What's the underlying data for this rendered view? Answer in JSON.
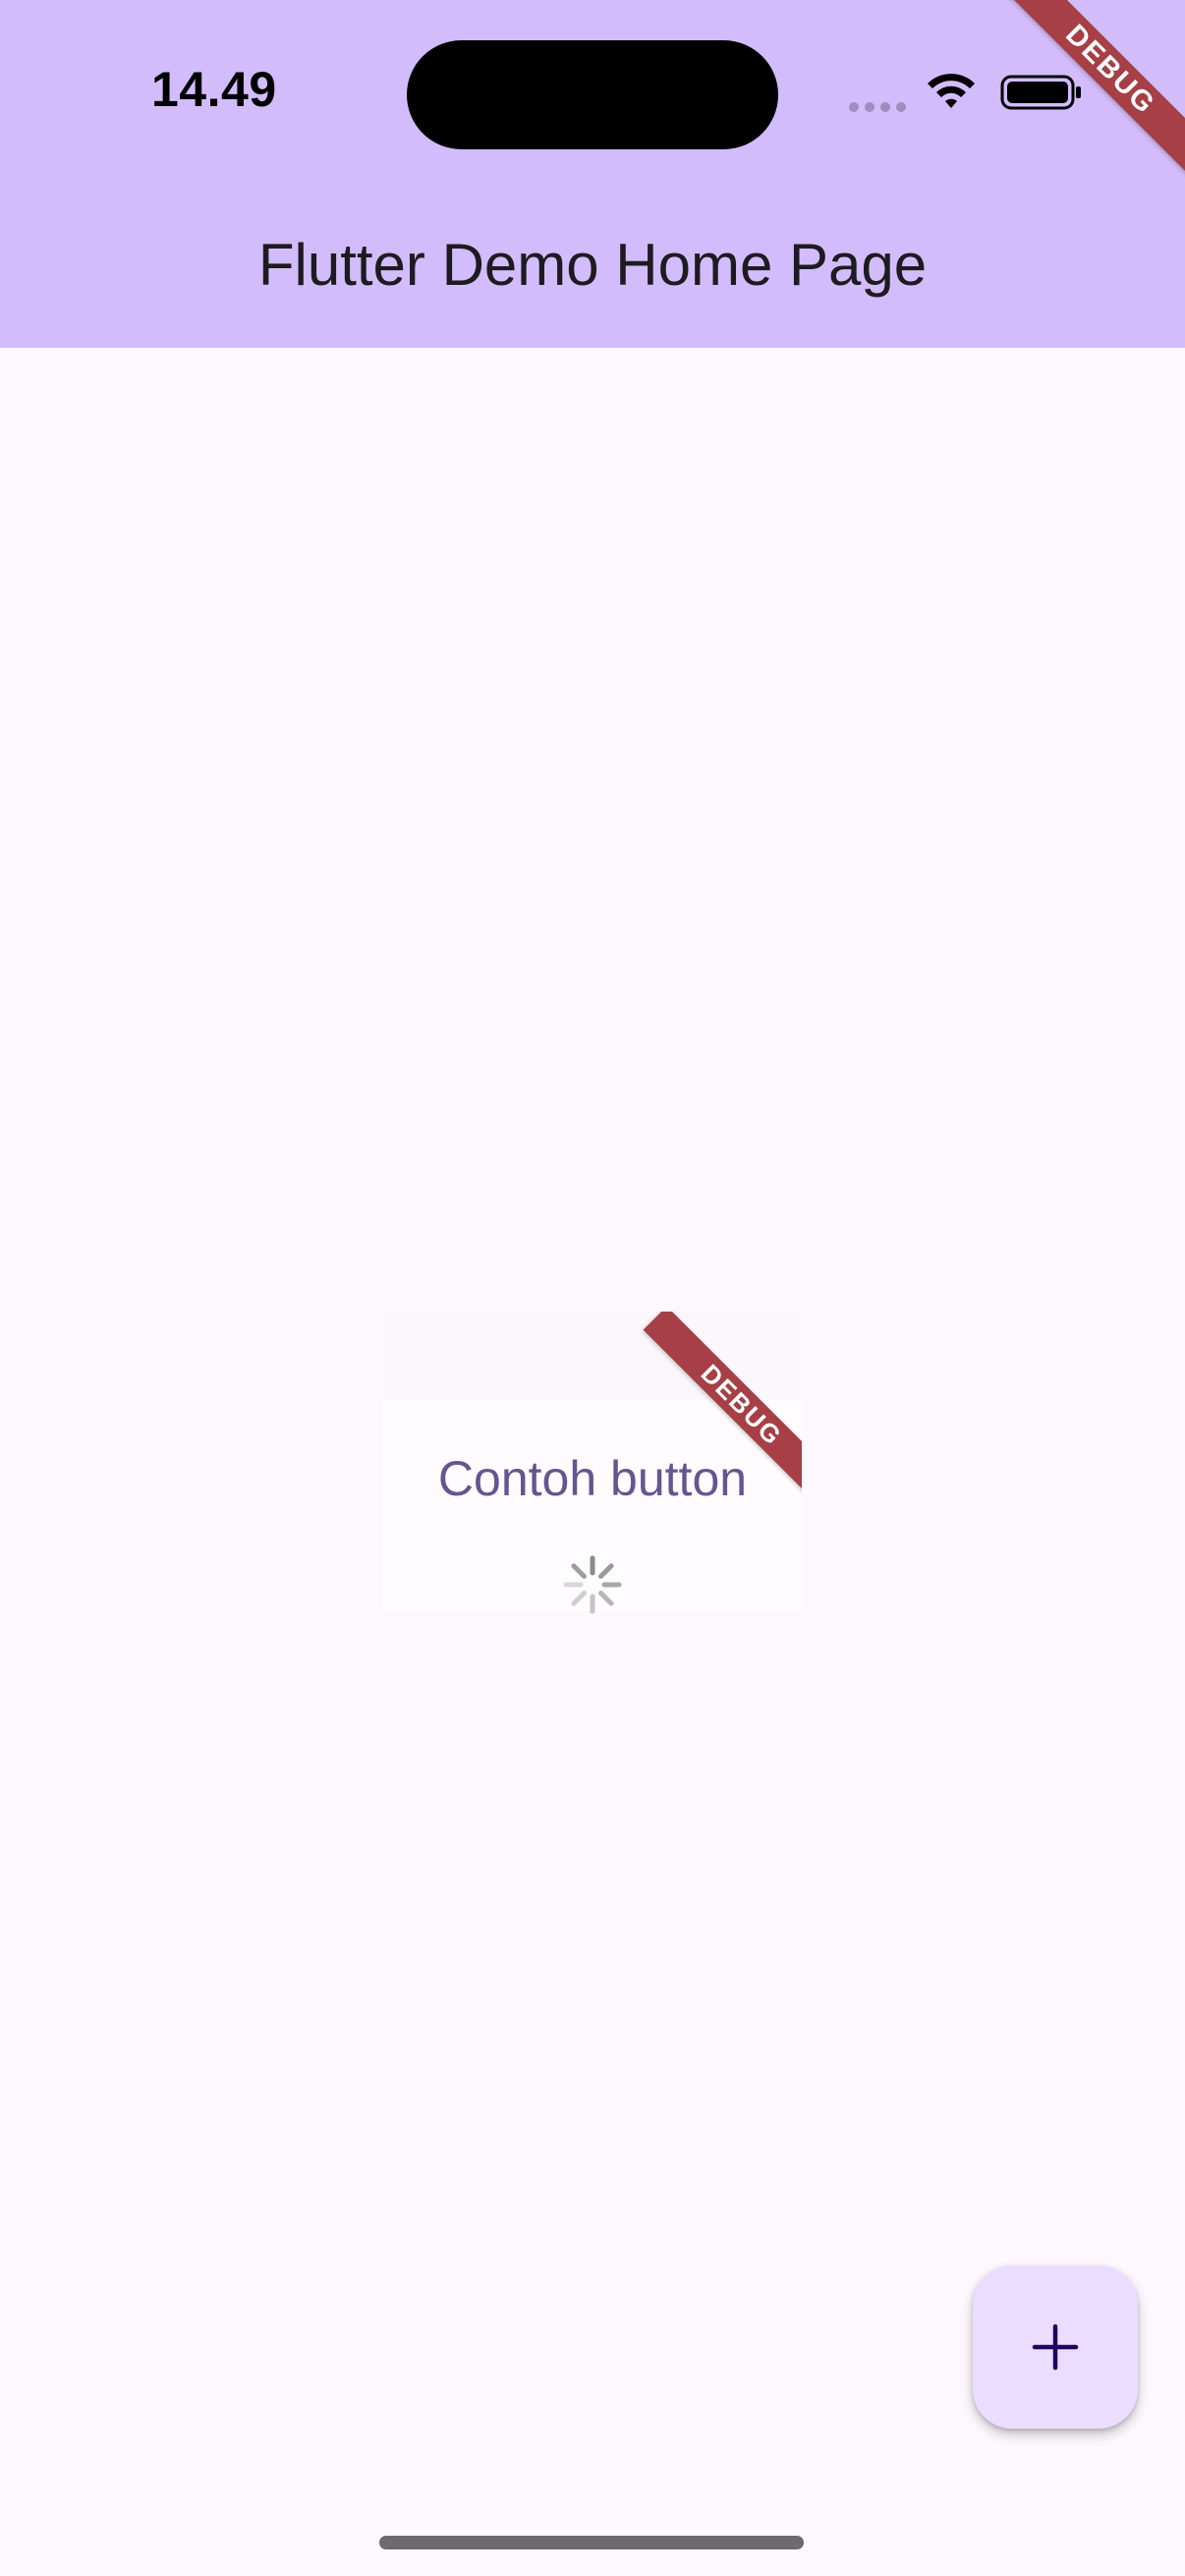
{
  "status_bar": {
    "time": "14.49",
    "icons": [
      "signal-dots-icon",
      "wifi-icon",
      "battery-icon"
    ]
  },
  "app_bar": {
    "title": "Flutter Demo Home Page",
    "color": "#d3bcfc"
  },
  "debug_banner": {
    "label": "DEBUG",
    "color": "#a63f46"
  },
  "popup": {
    "debug_label": "DEBUG",
    "button_label": "Contoh button",
    "button_color": "#65558f",
    "spinner": "activity-spinner-icon"
  },
  "fab": {
    "icon": "plus-icon",
    "color": "#eaddff"
  },
  "colors": {
    "background": "#fdf7fe",
    "title_text": "#1d1b20"
  }
}
